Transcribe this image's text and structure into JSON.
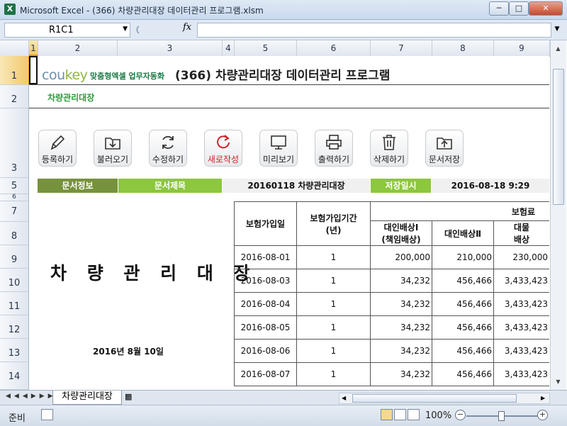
{
  "window": {
    "title": "Microsoft Excel - (366) 차량관리대장 데이터관리 프로그램.xlsm",
    "app_icon": "X"
  },
  "formula": {
    "name_box": "R1C1",
    "fx": "fx",
    "content": ""
  },
  "columns": [
    "1",
    "2",
    "3",
    "4",
    "5",
    "6",
    "7",
    "8",
    "9"
  ],
  "rows": [
    "1",
    "2",
    "3",
    "5",
    "6",
    "7",
    "8",
    "9",
    "10",
    "11",
    "12",
    "13",
    "14"
  ],
  "header": {
    "logo_main": "cou",
    "logo_accent": "key",
    "logo_sub": "맞춤형엑셀 업무자동화",
    "page_title": "(366) 차량관리대장 데이터관리 프로그램",
    "sub_title": "차량관리대장"
  },
  "toolbar": [
    {
      "label": "등록하기",
      "icon": "pencil-icon"
    },
    {
      "label": "불러오기",
      "icon": "folder-download-icon"
    },
    {
      "label": "수정하기",
      "icon": "refresh-icon"
    },
    {
      "label": "새로작성",
      "icon": "new-circle-icon",
      "color": "#d0202a"
    },
    {
      "label": "미리보기",
      "icon": "monitor-icon"
    },
    {
      "label": "출력하기",
      "icon": "printer-icon"
    },
    {
      "label": "삭제하기",
      "icon": "trash-icon"
    },
    {
      "label": "문서저장",
      "icon": "folder-upload-icon"
    }
  ],
  "info": {
    "doc_info_label": "문서정보",
    "doc_title_label": "문서제목",
    "doc_title_value": "20160118 차량관리대장",
    "save_label": "저장일시",
    "save_value": "2016-08-18 9:29"
  },
  "left_panel": {
    "big_title": "차 량 관 리 대 장",
    "date": "2016년 8월 10일"
  },
  "table": {
    "h_join_date": "보험가입일",
    "h_period_1": "보험가입기간",
    "h_period_2": "(년)",
    "h_premium": "보험료",
    "h_bi1_1": "대인배상Ⅰ",
    "h_bi1_2": "(책임배상)",
    "h_bi2": "대인배상Ⅱ",
    "h_prop_1": "대물",
    "h_prop_2": "배상",
    "rows": [
      {
        "date": "2016-08-01",
        "period": "1",
        "bi1": "200,000",
        "bi2": "210,000",
        "prop": "230,000"
      },
      {
        "date": "2016-08-03",
        "period": "1",
        "bi1": "34,232",
        "bi2": "456,466",
        "prop": "3,433,423"
      },
      {
        "date": "2016-08-04",
        "period": "1",
        "bi1": "34,232",
        "bi2": "456,466",
        "prop": "3,433,423"
      },
      {
        "date": "2016-08-05",
        "period": "1",
        "bi1": "34,232",
        "bi2": "456,466",
        "prop": "3,433,423"
      },
      {
        "date": "2016-08-06",
        "period": "1",
        "bi1": "34,232",
        "bi2": "456,466",
        "prop": "3,433,423"
      },
      {
        "date": "2016-08-07",
        "period": "1",
        "bi1": "34,232",
        "bi2": "456,466",
        "prop": "3,433,423"
      }
    ]
  },
  "sheet_tab": "차량관리대장",
  "status": {
    "ready": "준비",
    "zoom": "100%"
  },
  "colors": {
    "olive": "#77923c",
    "green": "#8dc63f",
    "grey": "#f0f0f0",
    "red": "#d0202a"
  }
}
